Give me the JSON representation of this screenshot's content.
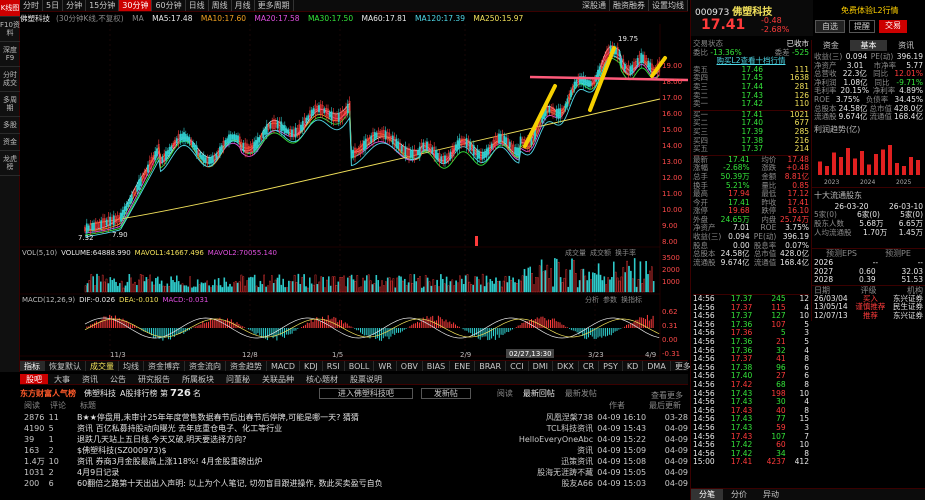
{
  "stock": {
    "code": "000973",
    "name": "佛塑科技",
    "price": "17.41",
    "change": "0.48",
    "pct": "2.68%",
    "chart_title": "佛塑科技",
    "chart_period": "(30分钟K线,不复权)"
  },
  "left_sidebar": [
    "K线图",
    "F10资料",
    "深度F9",
    "分时成交",
    "多周期",
    "多股",
    "资金",
    "龙虎榜"
  ],
  "top_tabs": [
    "分时",
    "5日",
    "分钟",
    "15分钟",
    "30分钟",
    "60分钟",
    "日线",
    "周线",
    "月线",
    "更多周期"
  ],
  "top_right_tabs": [
    "深股通",
    "融资融券",
    "设置均线"
  ],
  "ma_line": {
    "ma": "MA",
    "ma5": "MA5:17.48",
    "ma10": "MA10:17.60",
    "ma20": "MA20:17.58",
    "ma30": "MA30:17.50",
    "ma60": "MA60:17.81",
    "ma120": "MA120:17.39",
    "ma250": "MA250:15.97"
  },
  "price_axis": [
    "19.00",
    "18.00",
    "17.00",
    "16.00",
    "15.00",
    "14.00",
    "13.00",
    "12.00",
    "11.00",
    "10.00",
    "9.00",
    "8.00"
  ],
  "annotations": {
    "high": "19.75",
    "low": "7.32",
    "low2": "7.90",
    "date_marker": "02/27,13:30"
  },
  "vol_line": {
    "label": "VOL(5,10)",
    "vol": "VOLUME:64888.990",
    "mavol1": "MAVOL1:41667.496",
    "mavol2": "MAVOL2:70055.140",
    "tabs": [
      "成交量",
      "成交额",
      "换手率"
    ],
    "axis": [
      "3500",
      "2000",
      "1000"
    ]
  },
  "macd_line": {
    "label": "MACD(12,26,9)",
    "dif": "DIF:-0.026",
    "dea": "DEA:-0.010",
    "macd": "MACD:-0.031",
    "tabs": [
      "分析",
      "参数",
      "换指标"
    ],
    "axis": [
      "0.62",
      "0.31",
      "0.00",
      "-0.31"
    ]
  },
  "date_axis": [
    "11/3",
    "12/8",
    "1/5",
    "2/9",
    "3/23",
    "4/9"
  ],
  "bottom_tabs": [
    "指标",
    "恢复默认",
    "成交量",
    "均线",
    "资金博弈",
    "资金流向",
    "资金趋势",
    "MACD",
    "KDJ",
    "RSI",
    "BOLL",
    "WR",
    "OBV",
    "BIAS",
    "ENE",
    "BRAR",
    "CCI",
    "DMI",
    "DKX",
    "CR",
    "PSY",
    "KD",
    "DMA",
    "更多"
  ],
  "bottom_right": "模板",
  "news_tabs": [
    "股吧",
    "大事",
    "资讯",
    "公告",
    "研究报告",
    "所属板块",
    "问董秘",
    "关联品种",
    "核心题材",
    "股票说明"
  ],
  "news_header": {
    "title": "东方财富人气榜",
    "stock": "佛塑科技",
    "rank_label": "A股排行榜 第",
    "rank": "726",
    "rank_suffix": "名",
    "enter_button": "进入佛塑科技吧",
    "post_button": "发新帖",
    "sort_read": "阅读",
    "sort_latest": "最新回帖",
    "sort_new": "最新发帖",
    "view_more": "查看更多"
  },
  "news_cols": [
    "阅读",
    "评论",
    "标题",
    "作者",
    "最后更新"
  ],
  "news_rows": [
    [
      "2876",
      "11",
      "B★★停盘用,未审计25年年度营售数据春节后出春节后停牌,可能是哪一天? 猜猜",
      "风凰涅槃738",
      "04-09 16:10",
      "03-28"
    ],
    [
      "4190",
      "5",
      "资讯 百亿私募持股动向曝光 去年底重仓电子、化工等行业",
      "TCL科技资讯",
      "04-09 15:43",
      "04-09"
    ],
    [
      "39",
      "1",
      "退跌几天站上五日线,今天又破,明天要选择方向?",
      "HelloEveryOneAbc",
      "04-09 15:22",
      "04-09"
    ],
    [
      "163",
      "2",
      "$佛塑科技(SZ000973)$",
      "资讯",
      "04-09 15:09",
      "04-09"
    ],
    [
      "1.4万",
      "10",
      "资讯 券商3月金股最高上涨118%! 4月金股重磅出炉",
      "迅策资讯",
      "04-09 15:08",
      "04-09"
    ],
    [
      "1031",
      "2",
      "4月9日记录",
      "股海无涯踌不藏",
      "04-09 15:05",
      "04-09"
    ],
    [
      "200",
      "6",
      "60翻倍之路第十天出出入声明: 以上为个人笔记, 切勿盲目跟进操作, 数此买卖盈亏自负",
      "股友A66",
      "04-09 15:03",
      "04-09"
    ]
  ],
  "right_panel": {
    "tabs": [
      "自选",
      "提醒",
      "交易"
    ],
    "promo": "免费体验L2行情",
    "committee": {
      "label1": "委比",
      "v1": "-13.36%",
      "label2": "委差",
      "v2": "-525",
      "status_label": "交易状态",
      "status": "已收市"
    },
    "l2_link": "购买L2查看十档行情",
    "sell": [
      [
        "卖五",
        "17.46",
        "111"
      ],
      [
        "卖四",
        "17.45",
        "1638"
      ],
      [
        "卖三",
        "17.44",
        "281"
      ],
      [
        "卖二",
        "17.43",
        "126"
      ],
      [
        "卖一",
        "17.42",
        "110"
      ]
    ],
    "buy": [
      [
        "买一",
        "17.41",
        "1021"
      ],
      [
        "买二",
        "17.40",
        "677"
      ],
      [
        "买三",
        "17.39",
        "285"
      ],
      [
        "买四",
        "17.38",
        "216"
      ],
      [
        "买五",
        "17.37",
        "214"
      ]
    ],
    "stats": [
      [
        "最新",
        "17.41",
        "均价",
        "17.48"
      ],
      [
        "涨幅",
        "-2.68%",
        "涨跌",
        "+0.48"
      ],
      [
        "总手",
        "50.39万",
        "金额",
        "8.81亿"
      ],
      [
        "换手",
        "5.21%",
        "量比",
        "0.85"
      ],
      [
        "最高",
        "17.94",
        "最低",
        "17.12"
      ],
      [
        "今开",
        "17.41",
        "昨收",
        "17.41"
      ],
      [
        "涨停",
        "19.68",
        "跌停",
        "16.10"
      ],
      [
        "外盘",
        "24.65万",
        "内盘",
        "25.74万"
      ],
      [
        "净资产",
        "7.01",
        "ROE",
        "3.75%"
      ],
      [
        "收益(三)",
        "0.094",
        "PE(动)",
        "396.19"
      ],
      [
        "股息",
        "0.00",
        "股息率",
        "0.07%"
      ],
      [
        "总股本",
        "24.58亿",
        "总市值",
        "428.0亿"
      ],
      [
        "流通股",
        "9.674亿",
        "流通值",
        "168.4亿"
      ]
    ],
    "fin_tabs": [
      "资金",
      "基本",
      "资讯"
    ],
    "fin": [
      [
        "收益(三)",
        "0.094",
        "PE(动)",
        "396.19"
      ],
      [
        "净资产",
        "3.01",
        "市净率",
        "5.77"
      ],
      [
        "总营收",
        "22.3亿",
        "同比",
        "12.01%"
      ],
      [
        "净利润",
        "1.08亿",
        "同比",
        "-9.71%"
      ],
      [
        "毛利率",
        "20.15%",
        "净利率",
        "4.89%"
      ],
      [
        "ROE",
        "3.75%",
        "负债率",
        "34.45%"
      ],
      [
        "总股本",
        "24.58亿",
        "总市值",
        "428.0亿"
      ],
      [
        "流通股",
        "9.674亿",
        "流通值",
        "168.4亿"
      ]
    ],
    "profit_title": "利润趋势(亿)",
    "profit_years": [
      "2023",
      "2024",
      "2025"
    ],
    "profit_bars": [
      0.45,
      0.3,
      0.75,
      0.6,
      0.9,
      0.55,
      0.8,
      0.35,
      0.7,
      0.85,
      1.0,
      0.4,
      0.3,
      0.6,
      0.5
    ],
    "holders_title": "十大流通股东",
    "holders": [
      [
        "",
        "26-03-20",
        "26-03-10"
      ],
      [
        "5家(0)",
        "6家(0)",
        "5家(0)"
      ],
      [
        "股东人数",
        "5.68万",
        "6.65万"
      ],
      [
        "人均流通股",
        "1.70万",
        "1.45万"
      ]
    ],
    "forecast_tabs": [
      "预测EPS",
      "预测PE"
    ],
    "forecast": [
      [
        "2026",
        "--",
        "--"
      ],
      [
        "2027",
        "0.60",
        "32.03"
      ],
      [
        "2028",
        "0.39",
        "51.53"
      ]
    ],
    "rating_cols": [
      "日期",
      "评级",
      "机构"
    ],
    "ratings": [
      [
        "26/03/04",
        "买入",
        "东兴证券"
      ],
      [
        "13/05/14",
        "谨慎推荐",
        "民生证券"
      ],
      [
        "12/07/13",
        "推荐",
        "东兴证券"
      ]
    ],
    "ticks": [
      [
        "14:56",
        "17.37",
        "245",
        "12"
      ],
      [
        "14:56",
        "17.37",
        "115",
        "4"
      ],
      [
        "14:56",
        "17.37",
        "127",
        "10"
      ],
      [
        "14:56",
        "17.36",
        "107",
        "5"
      ],
      [
        "14:56",
        "17.36",
        "5",
        "3"
      ],
      [
        "14:56",
        "17.36",
        "21",
        "5"
      ],
      [
        "14:56",
        "17.36",
        "32",
        "4"
      ],
      [
        "14:56",
        "17.37",
        "41",
        "8"
      ],
      [
        "14:56",
        "17.38",
        "96",
        "6"
      ],
      [
        "14:56",
        "17.40",
        "27",
        "6"
      ],
      [
        "14:56",
        "17.42",
        "68",
        "8"
      ],
      [
        "14:56",
        "17.43",
        "198",
        "10"
      ],
      [
        "14:56",
        "17.43",
        "30",
        "4"
      ],
      [
        "14:56",
        "17.43",
        "40",
        "8"
      ],
      [
        "14:56",
        "17.43",
        "77",
        "15"
      ],
      [
        "14:56",
        "17.43",
        "59",
        "3"
      ],
      [
        "14:56",
        "17.43",
        "107",
        "7"
      ],
      [
        "14:56",
        "17.42",
        "60",
        "10"
      ],
      [
        "14:56",
        "17.42",
        "34",
        "8"
      ],
      [
        "15:00",
        "17.41",
        "4237",
        "412"
      ]
    ],
    "tick_tabs": [
      "分笔",
      "分价",
      "异动"
    ]
  }
}
